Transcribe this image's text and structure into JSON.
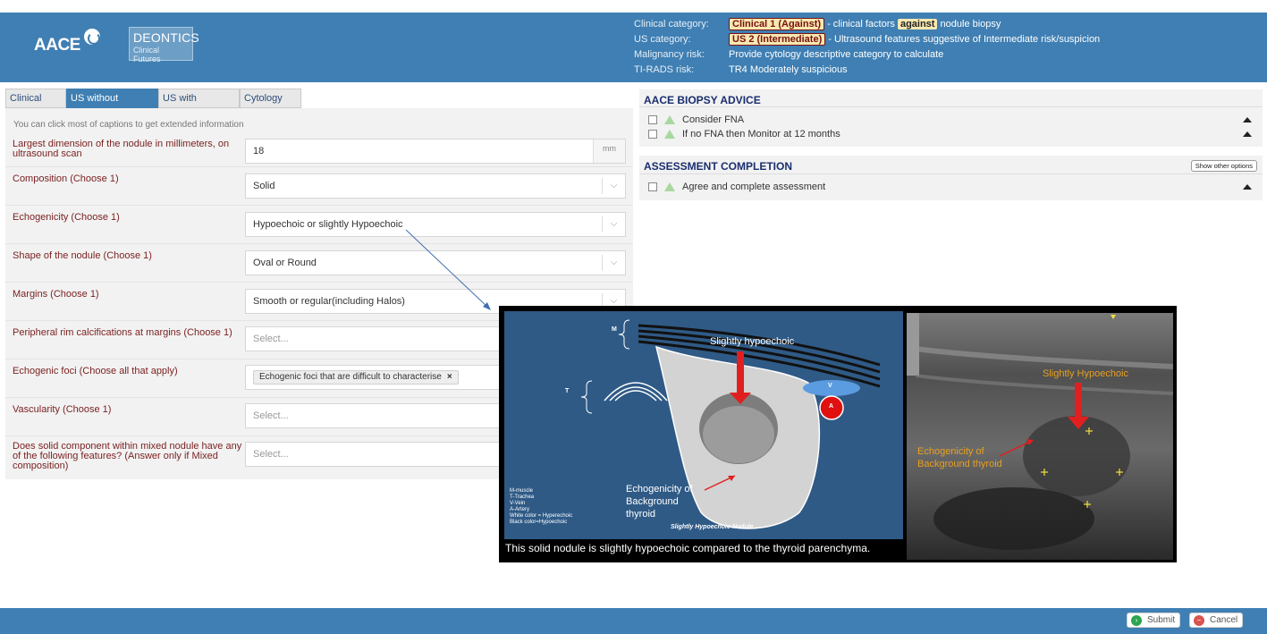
{
  "header": {
    "logo_aace": "AACE",
    "logo_deontics": "DEONTICS",
    "logo_deontics_sub": "Clinical Futures",
    "rows": [
      {
        "label": "Clinical category:",
        "pill": "Clinical 1 (Against)",
        "pre": " - clinical factors ",
        "mid_pill": "against",
        "post": " nodule biopsy"
      },
      {
        "label": "US category:",
        "pill": "US 2 (Intermediate)",
        "text": " - Ultrasound features suggestive of Intermediate risk/suspicion"
      },
      {
        "label": "Malignancy risk:",
        "text": "Provide cytology descriptive category to calculate"
      },
      {
        "label": "TI-RADS risk:",
        "text": "TR4 Moderately suspicious"
      }
    ]
  },
  "tabs": [
    "Clinical",
    "US without illustration",
    "US with illustration",
    "Cytology"
  ],
  "active_tab": "US without illustration",
  "hint": "You can click most of captions to get extended information",
  "questions": [
    {
      "label": "Largest dimension of the nodule in millimeters, on ultrasound scan",
      "value": "18",
      "unit": "mm"
    },
    {
      "label": "Composition (Choose 1)",
      "value": "Solid"
    },
    {
      "label": "Echogenicity (Choose 1)",
      "value": "Hypoechoic or slightly Hypoechoic"
    },
    {
      "label": "Shape of the nodule (Choose 1)",
      "value": "Oval or Round"
    },
    {
      "label": "Margins (Choose 1)",
      "value": "Smooth or regular(including Halos)"
    },
    {
      "label": "Peripheral rim calcifications at margins (Choose 1)",
      "placeholder": "Select..."
    },
    {
      "label": "Echogenic foci (Choose all that apply)",
      "tag": "Echogenic foci that are difficult to characterise",
      "tag_remove": "×"
    },
    {
      "label": "Vascularity (Choose 1)",
      "placeholder": "Select..."
    },
    {
      "label": "Does solid component within mixed nodule have any of the following features? (Answer only if Mixed composition)",
      "placeholder": "Select..."
    }
  ],
  "biopsy": {
    "title": "AACE BIOPSY ADVICE",
    "items": [
      "Consider FNA",
      "If no FNA then Monitor at 12 months"
    ]
  },
  "assessment": {
    "title": "ASSESSMENT COMPLETION",
    "other_options": "Show other options",
    "items": [
      "Agree and complete assessment"
    ]
  },
  "illustration": {
    "label_m": "M",
    "label_t": "T",
    "label_v": "V",
    "label_a": "A",
    "slightly_hypoechoic": "Slightly hypoechoic",
    "echogenicity_background": [
      "Echogenicity of",
      "Background",
      "thyroid"
    ],
    "legend": [
      "M-muscle",
      "T-Trachea",
      "V-Vein",
      "A-Artery",
      "White color = Hyperechoic",
      "Black color=Hypoechoic"
    ],
    "nodule_title": "Slightly Hypoechoic Nodule",
    "caption": "This solid nodule is slightly hypoechoic compared to the thyroid parenchyma.",
    "us_slightly": "Slightly Hypoechoic",
    "us_echo": [
      "Echogenicity of",
      "Background thyroid"
    ]
  },
  "footer": {
    "submit": "Submit",
    "cancel": "Cancel"
  },
  "colors": {
    "header": "#3f7fb3",
    "label": "#7a1f1f",
    "title": "#1a2e6e"
  }
}
